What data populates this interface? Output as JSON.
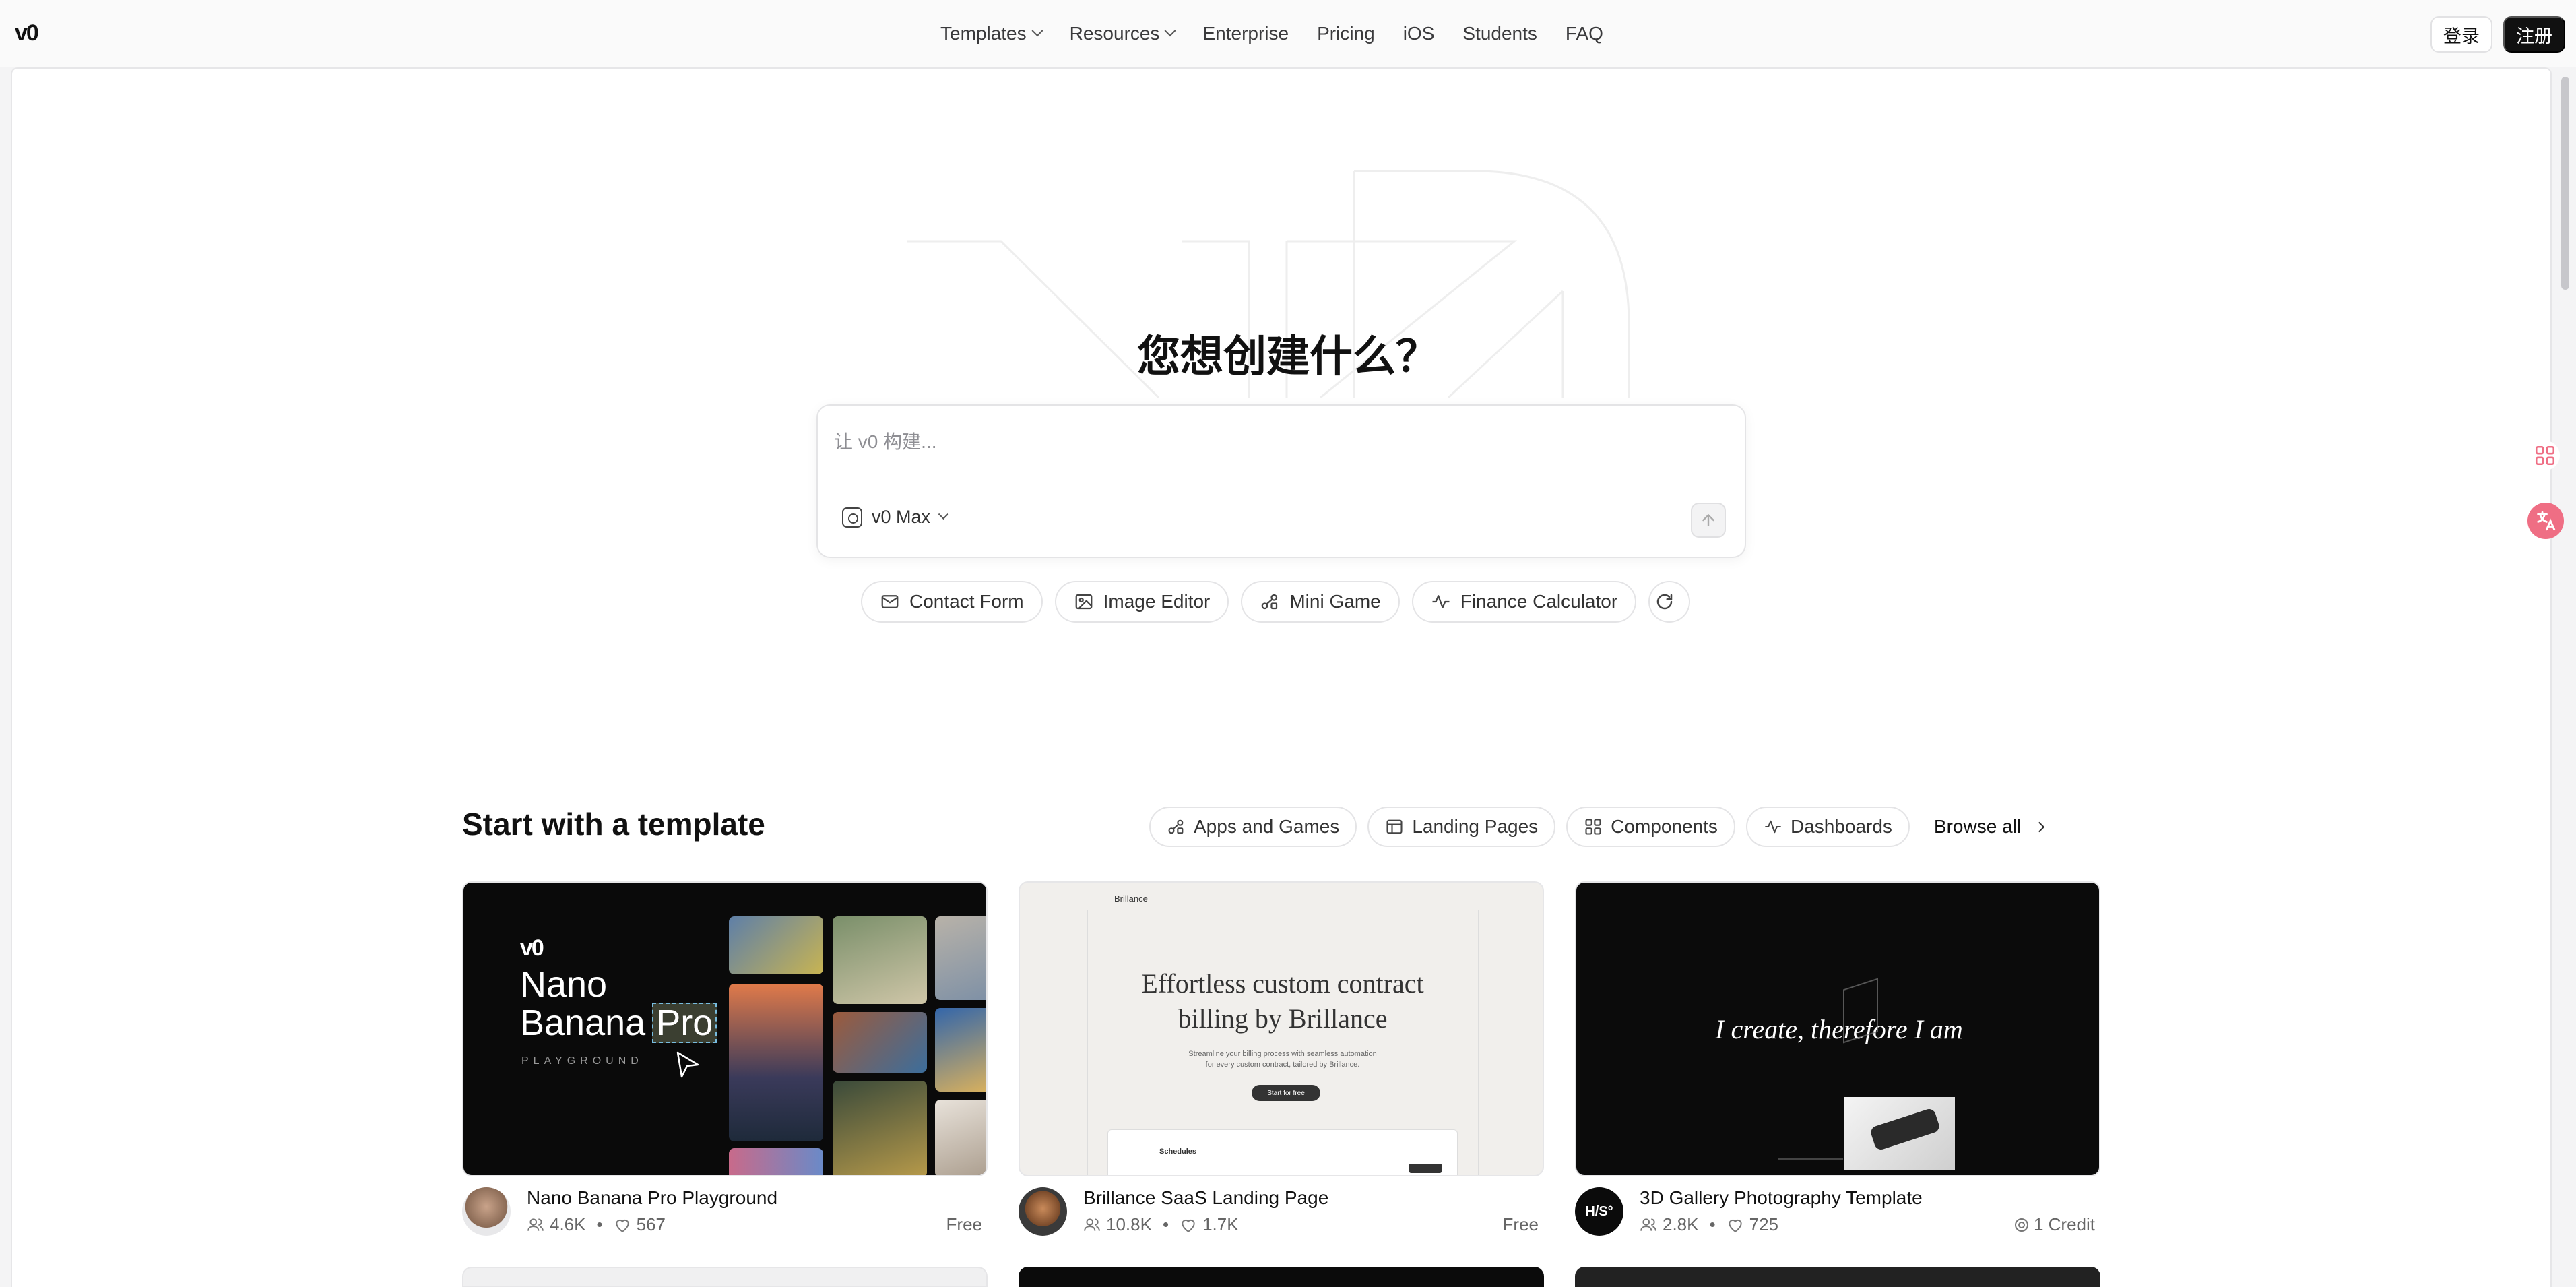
{
  "nav": {
    "logo": "v0",
    "links": [
      {
        "label": "Templates",
        "dropdown": true
      },
      {
        "label": "Resources",
        "dropdown": true
      },
      {
        "label": "Enterprise",
        "dropdown": false
      },
      {
        "label": "Pricing",
        "dropdown": false
      },
      {
        "label": "iOS",
        "dropdown": false
      },
      {
        "label": "Students",
        "dropdown": false
      },
      {
        "label": "FAQ",
        "dropdown": false
      }
    ],
    "login": "登录",
    "signup": "注册"
  },
  "hero": {
    "title": "您想创建什么？",
    "placeholder": "让 v0 构建...",
    "model": "v0 Max"
  },
  "suggestions": [
    {
      "label": "Contact Form",
      "icon": "mail-icon"
    },
    {
      "label": "Image Editor",
      "icon": "image-icon"
    },
    {
      "label": "Mini Game",
      "icon": "game-icon"
    },
    {
      "label": "Finance Calculator",
      "icon": "activity-icon"
    }
  ],
  "templates": {
    "title": "Start with a template",
    "tabs": [
      {
        "label": "Apps and Games",
        "icon": "apps-icon"
      },
      {
        "label": "Landing Pages",
        "icon": "layout-icon"
      },
      {
        "label": "Components",
        "icon": "grid-icon"
      },
      {
        "label": "Dashboards",
        "icon": "activity-icon"
      }
    ],
    "browse": "Browse all",
    "cards": [
      {
        "name": "Nano Banana Pro Playground",
        "users": "4.6K",
        "likes": "567",
        "price": "Free",
        "thumb_logo": "v0",
        "thumb_line1": "Nano",
        "thumb_line2": "Banana",
        "thumb_highlight": "Pro",
        "thumb_sub": "PLAYGROUND"
      },
      {
        "name": "Brillance SaaS Landing Page",
        "users": "10.8K",
        "likes": "1.7K",
        "price": "Free",
        "thumb_brand": "Brillance",
        "thumb_heading1": "Effortless custom contract",
        "thumb_heading2": "billing by Brillance",
        "thumb_sub1": "Streamline your billing process with seamless automation",
        "thumb_sub2": "for every custom contract, tailored by Brillance.",
        "thumb_cta": "Start for free",
        "thumb_panel_title": "Schedules"
      },
      {
        "name": "3D Gallery Photography Template",
        "users": "2.8K",
        "likes": "725",
        "price": "1 Credit",
        "avatar_text": "H/S°",
        "thumb_text": "I create, therefore I am"
      }
    ]
  },
  "colors": {
    "accent_dark": "#111111",
    "float_pink": "#ef6e84"
  }
}
